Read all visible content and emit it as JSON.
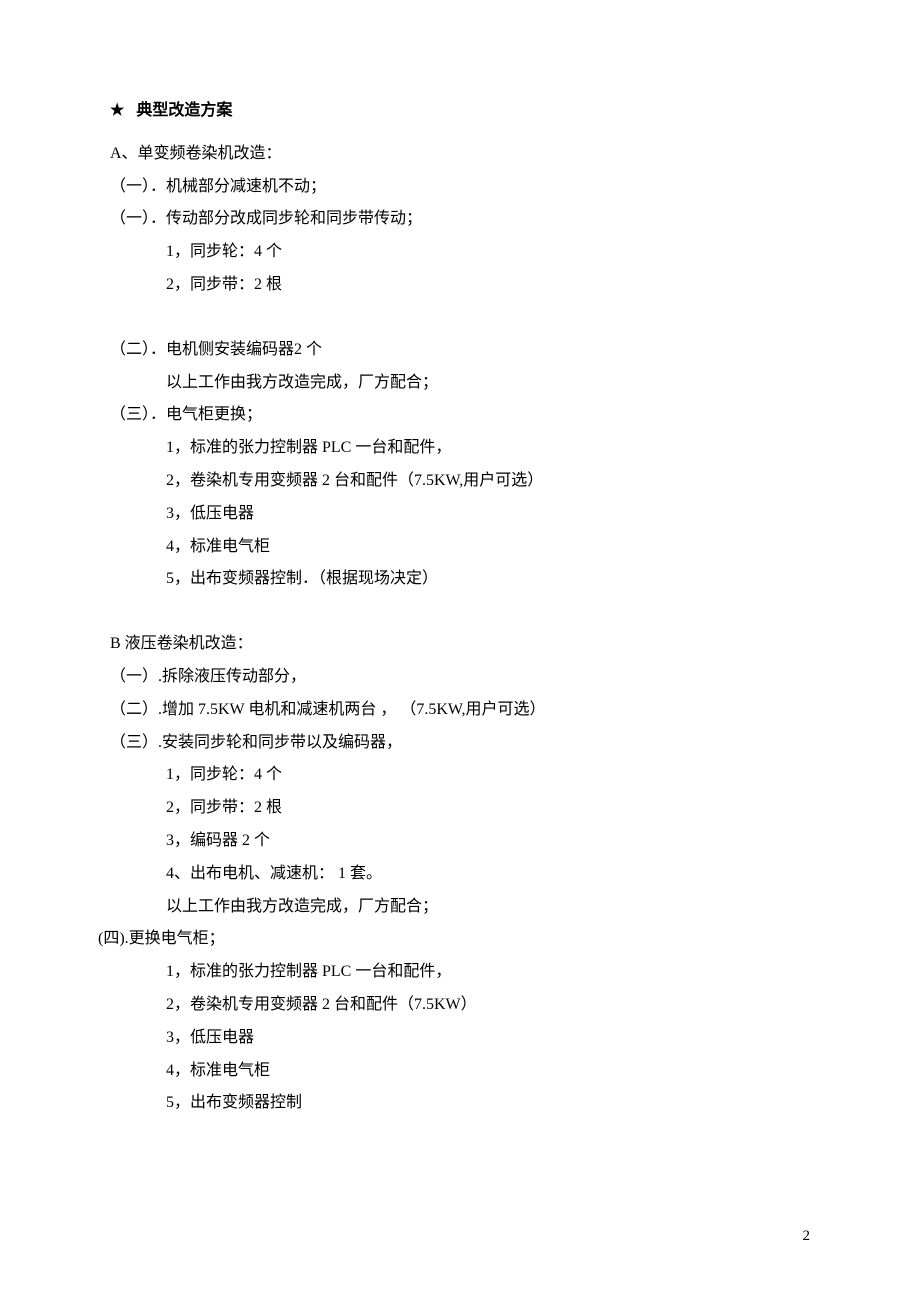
{
  "heading": {
    "star": "★",
    "title": "典型改造方案"
  },
  "sectionA": {
    "title": "A、单变频卷染机改造：",
    "item1": "（一）．机械部分减速机不动；",
    "item2": "（一）．传动部分改成同步轮和同步带传动；",
    "sub1": "1，同步轮：4  个",
    "sub2": "2，同步带：2  根",
    "item3": "（二）．电机侧安装编码器2 个",
    "item3note": "以上工作由我方改造完成，厂方配合；",
    "item4": "（三）．电气柜更换；",
    "sub4_1": "1，标准的张力控制器  PLC  一台和配件，",
    "sub4_2": "2，卷染机专用变频器  2  台和配件（7.5KW,用户可选）",
    "sub4_3": "3，低压电器",
    "sub4_4": "4，标准电气柜",
    "sub4_5": "5，出布变频器控制．（根据现场决定）"
  },
  "sectionB": {
    "title": "B 液压卷染机改造：",
    "item1": "（一）.拆除液压传动部分，",
    "item2": "（二）.增加  7.5KW  电机和减速机两台  ，  （7.5KW,用户可选）",
    "item3": "（三）.安装同步轮和同步带以及编码器，",
    "sub3_1": "1，同步轮：4  个",
    "sub3_2": "2，同步带：2  根",
    "sub3_3": "3，编码器  2  个",
    "sub3_4": "4、出布电机、减速机： 1 套。",
    "sub3_note": "以上工作由我方改造完成，厂方配合；",
    "item4": "(四).更换电气柜；",
    "sub4_1": "1，标准的张力控制器  PLC  一台和配件，",
    "sub4_2": "2，卷染机专用变频器  2  台和配件（7.5KW）",
    "sub4_3": "3，低压电器",
    "sub4_4": "4，标准电气柜",
    "sub4_5": "5，出布变频器控制"
  },
  "pageNumber": "2"
}
